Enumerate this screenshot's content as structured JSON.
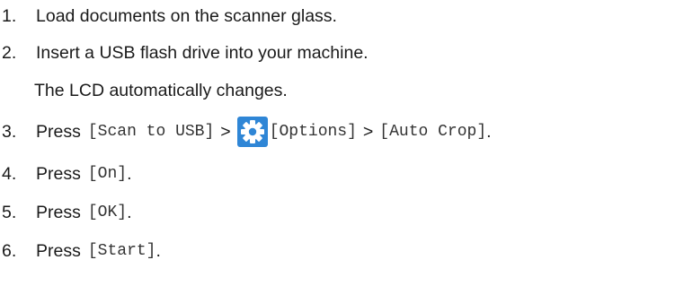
{
  "steps": [
    {
      "number": "1.",
      "text": "Load documents on the scanner glass."
    },
    {
      "number": "2.",
      "text": "Insert a USB flash drive into your machine.",
      "note": "The LCD automatically changes."
    },
    {
      "number": "3.",
      "press": "Press",
      "scan_to_usb": "[Scan to USB]",
      "sep1": ">",
      "gear_icon": "settings-gear",
      "options": "[Options]",
      "sep2": ">",
      "auto_crop": "[Auto Crop]",
      "end": "."
    },
    {
      "number": "4.",
      "press": "Press",
      "key": "[On]",
      "end": "."
    },
    {
      "number": "5.",
      "press": "Press",
      "key": "[OK]",
      "end": "."
    },
    {
      "number": "6.",
      "press": "Press",
      "key": "[Start]",
      "end": "."
    }
  ],
  "colors": {
    "gear_background": "#2f86d6",
    "gear_foreground": "#ffffff"
  }
}
